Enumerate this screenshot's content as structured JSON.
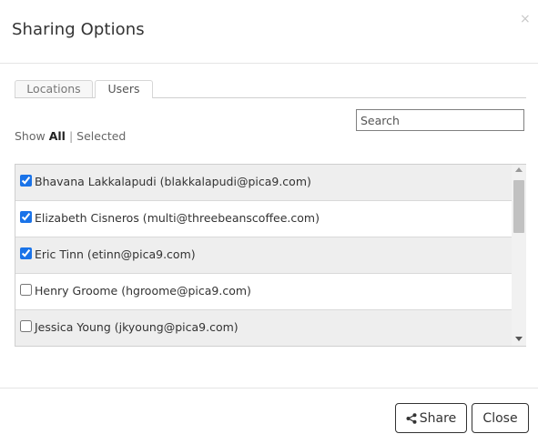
{
  "dialog": {
    "title": "Sharing Options",
    "close_glyph": "×"
  },
  "tabs": [
    {
      "label": "Locations",
      "active": false
    },
    {
      "label": "Users",
      "active": true
    }
  ],
  "search": {
    "placeholder": "Search",
    "value": ""
  },
  "filter": {
    "show_label": "Show",
    "all_label": "All",
    "separator": "|",
    "selected_label": "Selected"
  },
  "users": [
    {
      "label": "Bhavana Lakkalapudi (blakkalapudi@pica9.com)",
      "checked": true
    },
    {
      "label": "Elizabeth Cisneros (multi@threebeanscoffee.com)",
      "checked": true
    },
    {
      "label": "Eric Tinn (etinn@pica9.com)",
      "checked": true
    },
    {
      "label": "Henry Groome (hgroome@pica9.com)",
      "checked": false
    },
    {
      "label": "Jessica Young (jkyoung@pica9.com)",
      "checked": false
    }
  ],
  "footer": {
    "share_label": "Share",
    "share_icon": "share-icon",
    "close_label": "Close"
  },
  "colors": {
    "row_alt": "#eeeeee",
    "checkbox_accent": "#1a73e8",
    "border": "#cfcfcf"
  }
}
